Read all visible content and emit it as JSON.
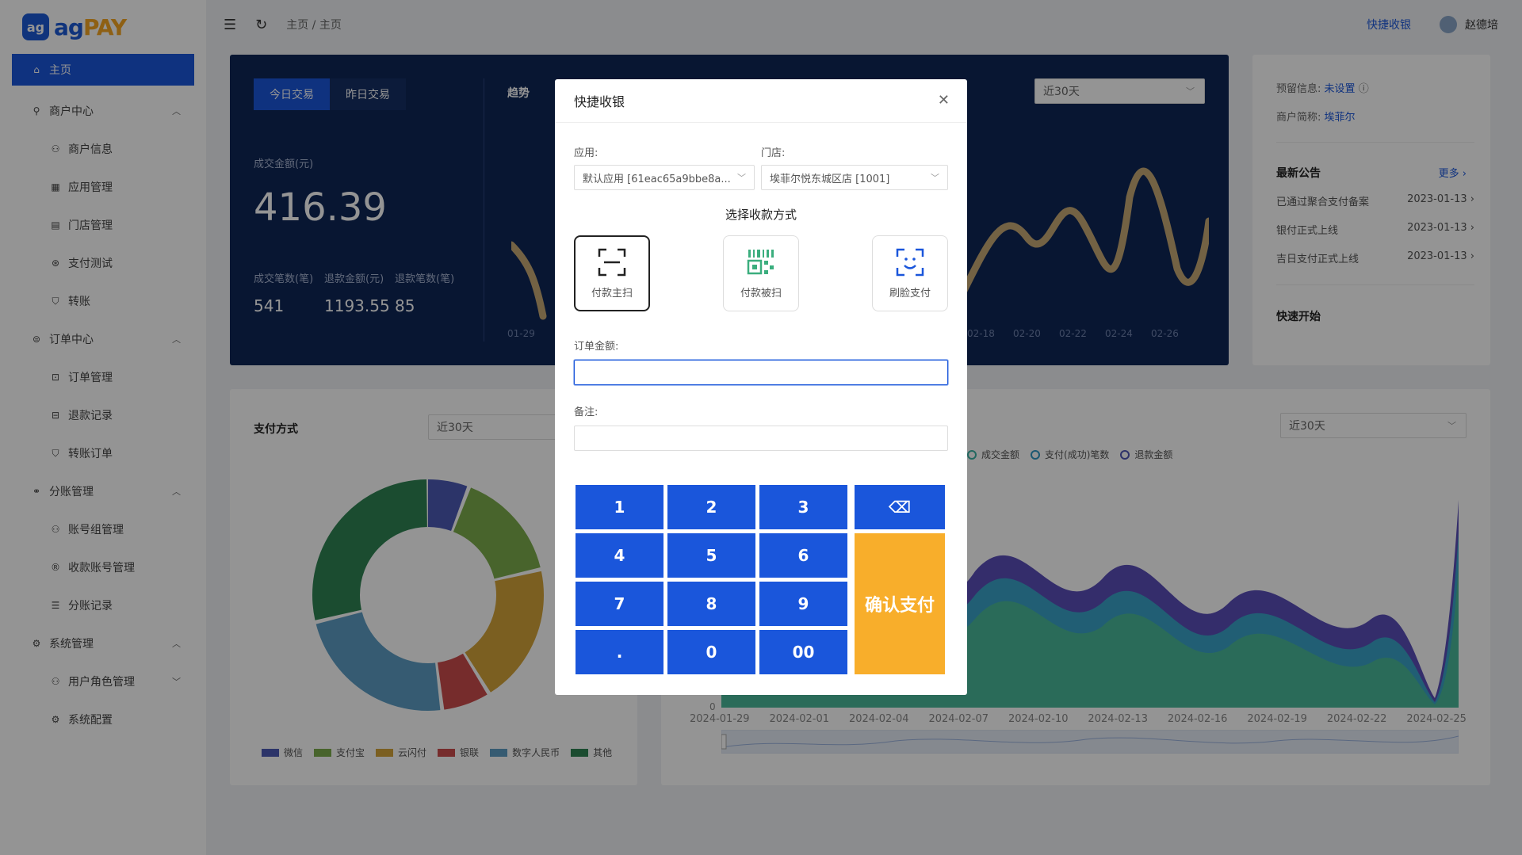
{
  "app": {
    "logo_mark": "ag",
    "logo_ag": "ag",
    "logo_pay": "PAY"
  },
  "sidebar": {
    "home": "主页",
    "merchant_center": "商户中心",
    "merchant_info": "商户信息",
    "app_mgmt": "应用管理",
    "store_mgmt": "门店管理",
    "pay_test": "支付测试",
    "transfer": "转账",
    "order_center": "订单中心",
    "order_mgmt": "订单管理",
    "refund_records": "退款记录",
    "transfer_orders": "转账订单",
    "split_mgmt": "分账管理",
    "account_group": "账号组管理",
    "receive_account": "收款账号管理",
    "split_records": "分账记录",
    "system_mgmt": "系统管理",
    "role_mgmt": "用户角色管理",
    "system_config": "系统配置"
  },
  "header": {
    "breadcrumb": "主页  /  主页",
    "quick_pay": "快捷收银",
    "user": "赵德培"
  },
  "stats": {
    "tab_today": "今日交易",
    "tab_yesterday": "昨日交易",
    "amount_label": "成交金额(元)",
    "amount": "416.39",
    "count_label": "成交笔数(笔)",
    "count": "541",
    "refund_amount_label": "退款金额(元)",
    "refund_amount": "1193.55",
    "refund_count_label": "退款笔数(笔)",
    "refund_count": "85",
    "trend_label": "趋势",
    "range": "近30天",
    "tick_left": "01-29",
    "ticks_right": [
      "02-18",
      "02-20",
      "02-22",
      "02-24",
      "02-26"
    ]
  },
  "info": {
    "reserve_label": "预留信息:",
    "reserve_value": "未设置",
    "merchant_label": "商户简称:",
    "merchant_value": "埃菲尔",
    "notice_title": "最新公告",
    "more": "更多",
    "notices": [
      {
        "title": "已通过聚合支付备案",
        "date": "2023-01-13"
      },
      {
        "title": "银付正式上线",
        "date": "2023-01-13"
      },
      {
        "title": "吉日支付正式上线",
        "date": "2023-01-13"
      }
    ],
    "quick_start": "快速开始"
  },
  "pay_method_card": {
    "title": "支付方式",
    "range": "近30天",
    "legend": [
      "微信",
      "支付宝",
      "云闪付",
      "银联",
      "数字人民币",
      "其他"
    ],
    "colors": [
      "#4c5ab5",
      "#7cad4c",
      "#d5a43a",
      "#cc4c4c",
      "#5e9ec4",
      "#2f8354"
    ]
  },
  "trend_card": {
    "range": "近30天",
    "legend": [
      "成交金额",
      "支付(成功)笔数",
      "退款金额"
    ],
    "y_zero": "0",
    "x_ticks": [
      "2024-01-29",
      "2024-02-01",
      "2024-02-04",
      "2024-02-07",
      "2024-02-10",
      "2024-02-13",
      "2024-02-16",
      "2024-02-19",
      "2024-02-22",
      "2024-02-25"
    ]
  },
  "modal": {
    "title": "快捷收银",
    "app_label": "应用:",
    "app_value": "默认应用 [61eac65a9bbe8a...",
    "store_label": "门店:",
    "store_value": "埃菲尔悦东城区店 [1001]",
    "pay_title": "选择收款方式",
    "methods": [
      "付款主扫",
      "付款被扫",
      "刷脸支付"
    ],
    "amount_label": "订单金额:",
    "remark_label": "备注:",
    "keys": [
      "1",
      "2",
      "3",
      "4",
      "5",
      "6",
      "7",
      "8",
      "9",
      ".",
      "0",
      "00"
    ],
    "confirm": "确认支付"
  }
}
